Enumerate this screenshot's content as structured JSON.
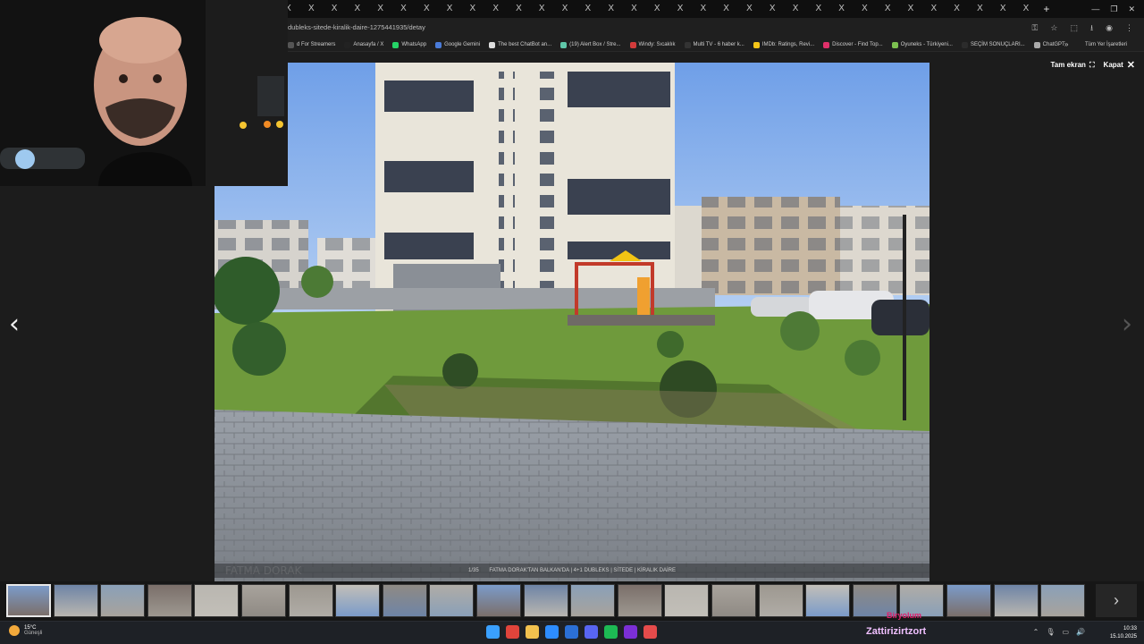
{
  "browser": {
    "tab_count": 45,
    "tab_glyph": "X",
    "new_tab": "+",
    "url": "dubleks-sitede-kiralik-daire-1275441935/detay",
    "bookmarks": [
      {
        "label": "d For Streamers",
        "color": "#555555"
      },
      {
        "label": "Anasayfa / X",
        "color": "#222222"
      },
      {
        "label": "WhatsApp",
        "color": "#25D366"
      },
      {
        "label": "Google Gemini",
        "color": "#4a7bd8"
      },
      {
        "label": "The best ChatBot an...",
        "color": "#dddddd"
      },
      {
        "label": "(19) Alert Box / Stre...",
        "color": "#5fc6a8"
      },
      {
        "label": "Windy: Sıcaklık",
        "color": "#d23b3b"
      },
      {
        "label": "Multi TV - 6 haber k...",
        "color": "#333333"
      },
      {
        "label": "IMDb: Ratings, Revi...",
        "color": "#f5c518"
      },
      {
        "label": "Discover - Find Top...",
        "color": "#e0306a"
      },
      {
        "label": "Oyuneks - Türkiyeni...",
        "color": "#7cc050"
      },
      {
        "label": "SEÇİM SONUÇLARI...",
        "color": "#2b2b2b"
      },
      {
        "label": "ChatGPT",
        "color": "#aaaaaa"
      }
    ],
    "bookmarks_more": "»",
    "all_bookmarks": "Tüm Yer İşaretleri"
  },
  "viewer": {
    "fullscreen_label": "Tam ekran",
    "close_label": "Kapat",
    "prev_arrow": "‹",
    "next_arrow": "›",
    "counter": "1/35",
    "caption": "FATMA DORAK'TAN BALKAN'DA | 4+1 DUBLEKS | SİTEDE | KİRALIK DAİRE",
    "watermark": "FATMA DORAK",
    "collapse_icon": "▼",
    "thumbnail_count": 23,
    "thumb_next": "›"
  },
  "overlay": {
    "streamer_name": "Zattirizirtzort",
    "chat_name": "Biryolum"
  },
  "taskbar": {
    "temperature": "15°C",
    "weather": "Güneşli",
    "time": "10:33",
    "date": "15.10.2025",
    "app_colors": [
      "#3aa0ff",
      "#e0443b",
      "#f2c14e",
      "#2d8cff",
      "#2b6fd6",
      "#5865F2",
      "#1db954",
      "#7b2fd6",
      "#e54b4b"
    ]
  }
}
